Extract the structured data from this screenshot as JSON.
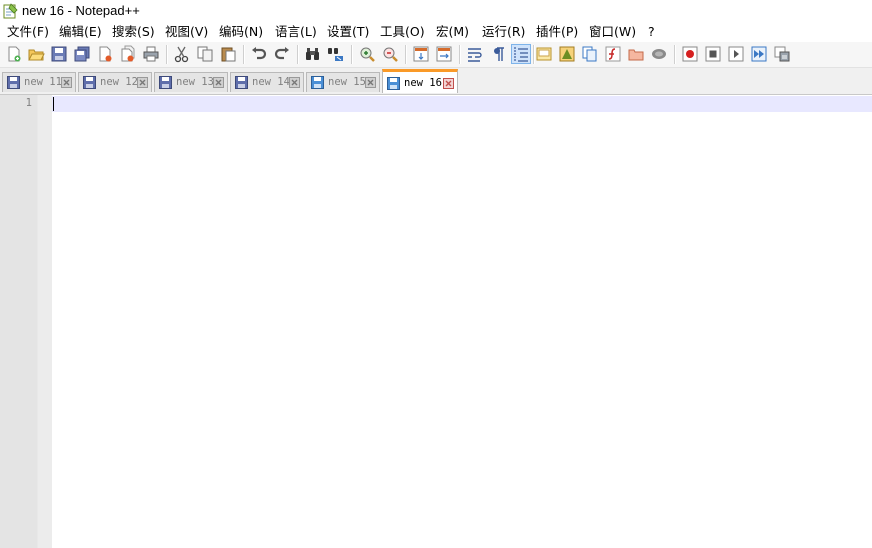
{
  "window": {
    "title": "new 16 - Notepad++"
  },
  "menu": [
    "文件(F)",
    "编辑(E)",
    "搜索(S)",
    "视图(V)",
    "编码(N)",
    "语言(L)",
    "设置(T)",
    "工具(O)",
    "宏(M)",
    "运行(R)",
    "插件(P)",
    "窗口(W)",
    "?"
  ],
  "toolbar": {
    "icons": [
      "new-file-icon",
      "open-file-icon",
      "save-icon",
      "save-all-icon",
      "close-icon",
      "close-all-icon",
      "print-icon",
      "cut-icon",
      "copy-icon",
      "paste-icon",
      "undo-icon",
      "redo-icon",
      "find-icon",
      "replace-icon",
      "zoom-in-icon",
      "zoom-out-icon",
      "sync-vertical-icon",
      "sync-horizontal-icon",
      "word-wrap-icon",
      "show-all-chars-icon",
      "indent-guide-icon",
      "user-language-icon",
      "doc-map-icon",
      "document-list-icon",
      "function-list-icon",
      "folder-workspace-icon",
      "monitoring-icon",
      "macro-record-icon",
      "macro-stop-icon",
      "macro-play-icon",
      "macro-run-multiple-icon",
      "macro-save-icon"
    ]
  },
  "tabs": [
    {
      "label": "new 11",
      "active": false
    },
    {
      "label": "new 12",
      "active": false
    },
    {
      "label": "new 13",
      "active": false
    },
    {
      "label": "new 14",
      "active": false
    },
    {
      "label": "new 15",
      "active": false
    },
    {
      "label": "new 16",
      "active": true
    }
  ],
  "editor": {
    "line_numbers": [
      "1"
    ],
    "content": ""
  },
  "colors": {
    "active_tab_accent": "#fa9a28",
    "current_line": "#e8e8ff",
    "gutter": "#e4e4e4"
  }
}
